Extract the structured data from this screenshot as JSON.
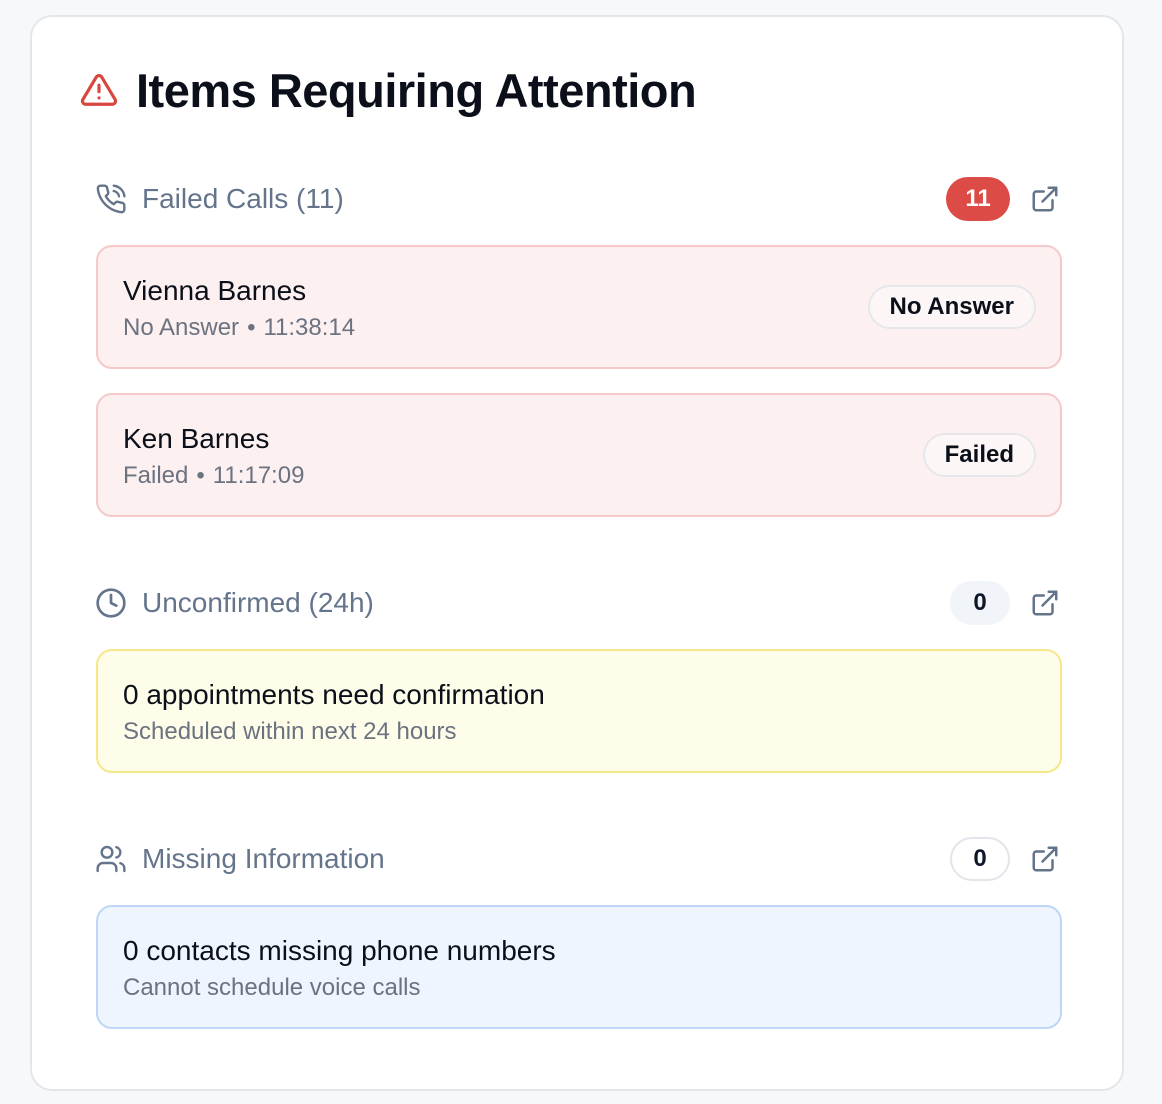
{
  "card": {
    "title": "Items Requiring Attention",
    "title_icon": "alert-triangle-icon"
  },
  "failed_calls": {
    "icon": "phone-missed-icon",
    "title": "Failed Calls (11)",
    "count": "11",
    "link_icon": "external-link-icon",
    "items": [
      {
        "name": "Vienna Barnes",
        "status": "No Answer",
        "time": "11:38:14",
        "badge": "No Answer"
      },
      {
        "name": "Ken Barnes",
        "status": "Failed",
        "time": "11:17:09",
        "badge": "Failed"
      }
    ]
  },
  "unconfirmed": {
    "icon": "clock-icon",
    "title": "Unconfirmed (24h)",
    "count": "0",
    "link_icon": "external-link-icon",
    "summary": "0 appointments need confirmation",
    "detail": "Scheduled within next 24 hours"
  },
  "missing_info": {
    "icon": "users-icon",
    "title": "Missing Information",
    "count": "0",
    "link_icon": "external-link-icon",
    "summary": "0 contacts missing phone numbers",
    "detail": "Cannot schedule voice calls"
  },
  "separator": "•",
  "colors": {
    "danger": "#dc4b45",
    "muted_text": "#64748b",
    "red_card_bg": "#fdf0f0",
    "yellow_card_bg": "#fefde9",
    "blue_card_bg": "#eff5fe"
  }
}
